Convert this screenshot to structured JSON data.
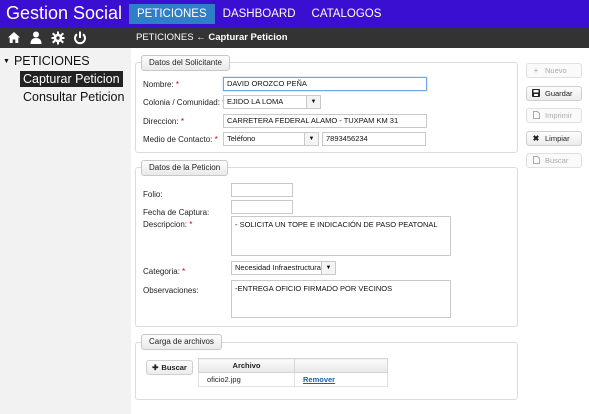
{
  "app": {
    "title": "Gestion Social"
  },
  "topnav": {
    "items": [
      {
        "label": "PETICIONES",
        "active": true
      },
      {
        "label": "DASHBOARD",
        "active": false
      },
      {
        "label": "CATALOGOS",
        "active": false
      }
    ]
  },
  "toolbar_icons": [
    "home-icon",
    "user-icon",
    "gear-icon",
    "power-icon"
  ],
  "breadcrumb": {
    "parent": "PETICIONES",
    "separator": "←",
    "current": "Capturar Peticion"
  },
  "sidebar": {
    "root": "PETICIONES",
    "items": [
      {
        "label": "Capturar Peticion",
        "selected": true
      },
      {
        "label": "Consultar Peticion",
        "selected": false
      }
    ]
  },
  "solicitante": {
    "legend": "Datos del Solicitante",
    "nombre_label": "Nombre:",
    "nombre_value": "DAVID OROZCO PEÑA",
    "colonia_label": "Colonia / Comunidad:",
    "colonia_value": "EJIDO LA LOMA",
    "direccion_label": "Direccion:",
    "direccion_value": "CARRETERA FEDERAL ALAMO - TUXPAM KM 31",
    "medio_label": "Medio de Contacto:",
    "medio_value": "Teléfono",
    "telefono_value": "7893456234"
  },
  "peticion": {
    "legend": "Datos de la Peticion",
    "folio_label": "Folio:",
    "folio_value": "",
    "fecha_label": "Fecha de Captura:",
    "fecha_value": "",
    "descripcion_label": "Descripcion:",
    "descripcion_value": "- SOLICITA UN TOPE E INDICACIÓN DE PASO PEATONAL",
    "categoria_label": "Categoria:",
    "categoria_value": "Necesidad Infraestructura",
    "observaciones_label": "Observaciones:",
    "observaciones_value": "-ENTREGA OFICIO FIRMADO POR VECINOS"
  },
  "archivos": {
    "legend": "Carga de archivos",
    "buscar_label": "Buscar",
    "column_archivo": "Archivo",
    "column_accion": "",
    "rows": [
      {
        "archivo": "oficio2.jpg",
        "accion": "Remover"
      }
    ]
  },
  "actions": {
    "nuevo": "Nuevo",
    "guardar": "Guardar",
    "imprimir": "Imprimir",
    "limpiar": "Limpiar",
    "buscar": "Buscar"
  },
  "colors": {
    "topbar": "#3a0fd1",
    "active_tab": "#2f7ec8",
    "dark_bar": "#333333",
    "sidebar_bg": "#f2f2f2"
  }
}
